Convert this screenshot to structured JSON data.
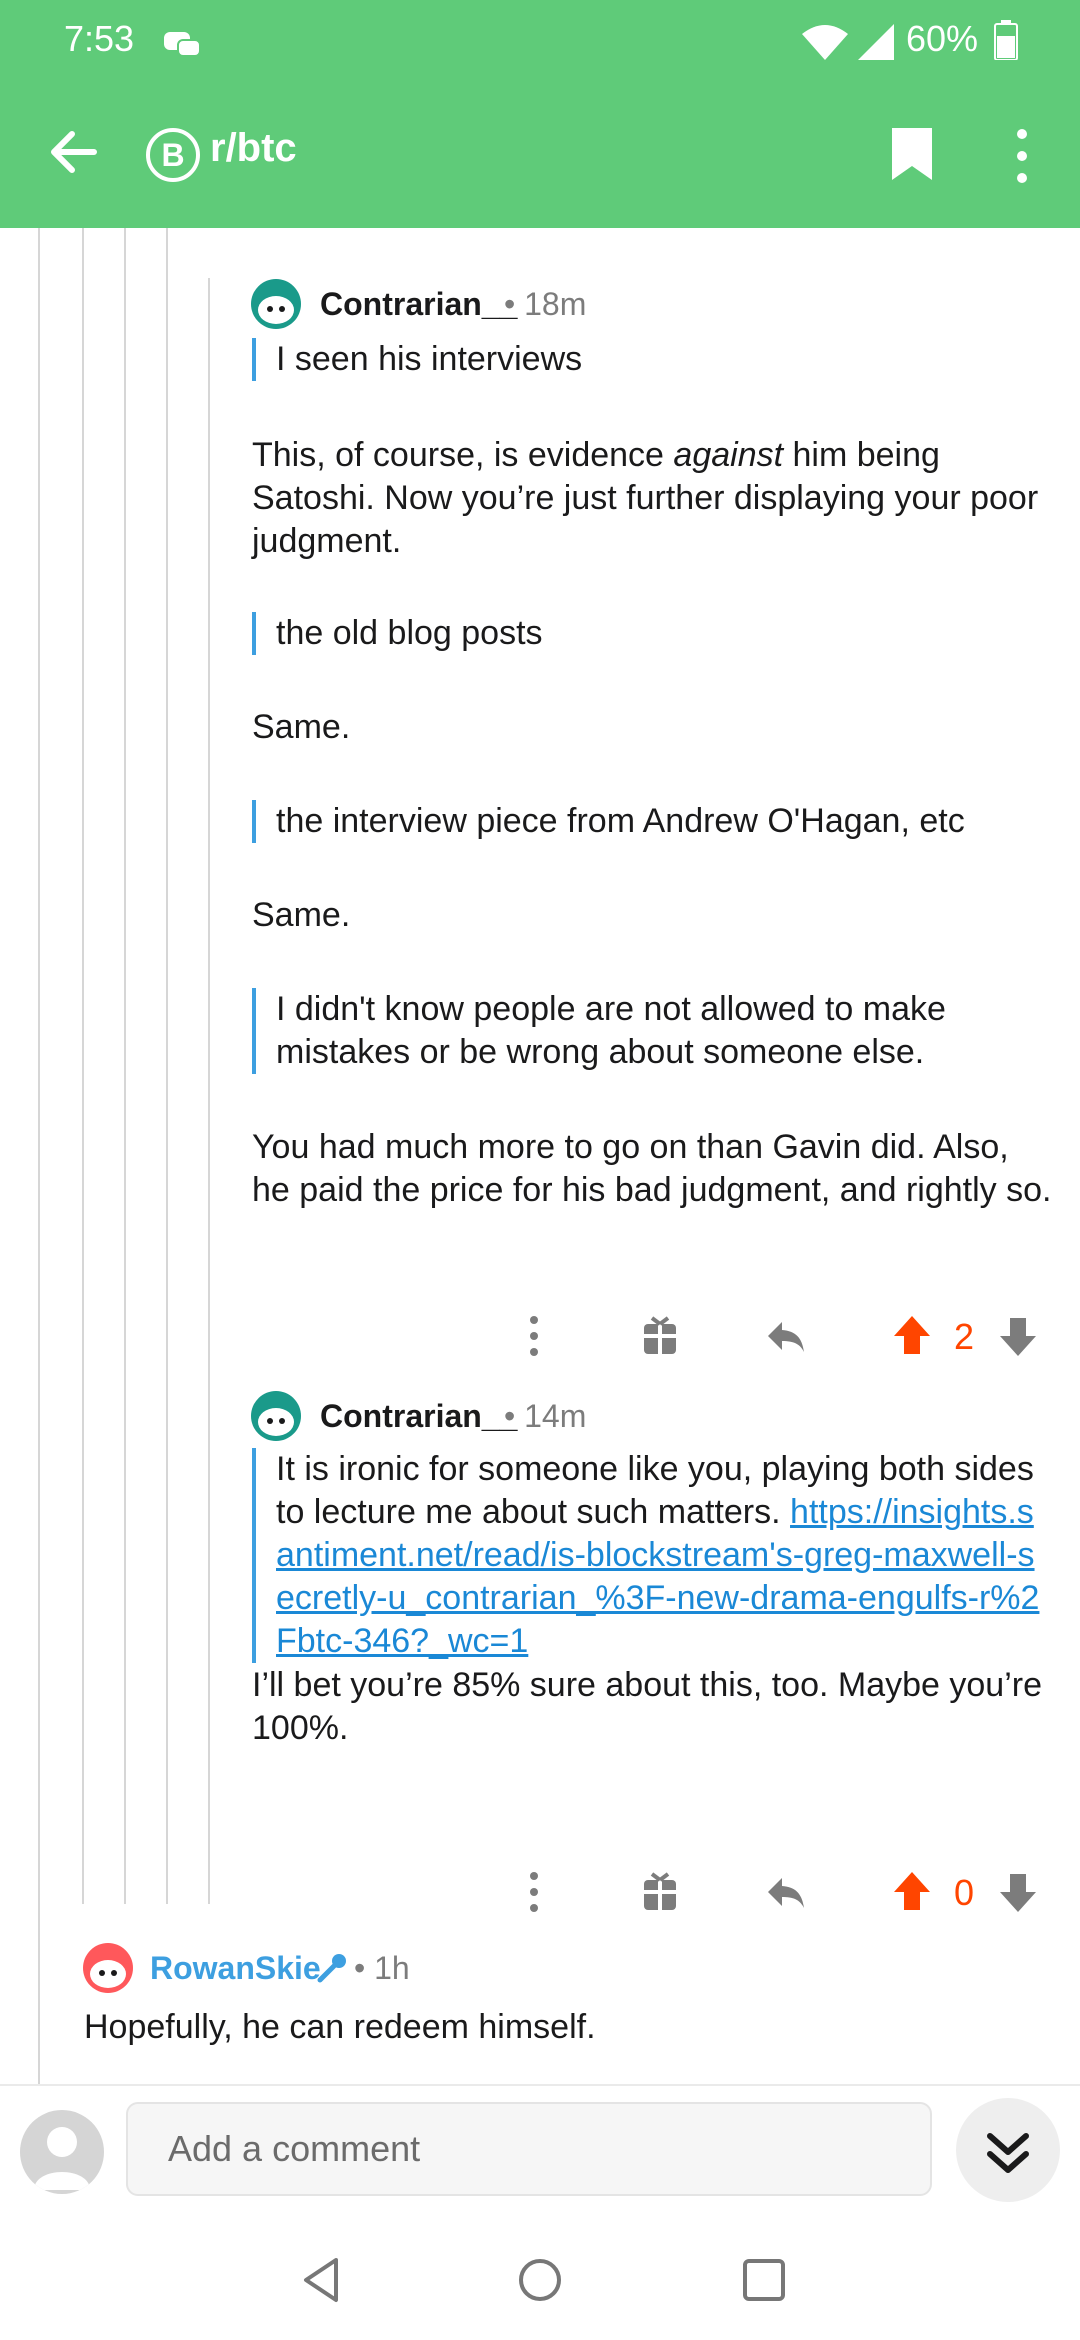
{
  "status_bar": {
    "time": "7:53",
    "battery": "60%"
  },
  "header": {
    "subreddit": "r/btc",
    "subreddit_icon_glyph": "B"
  },
  "comments": [
    {
      "author": "Contrarian__",
      "time": "• 18m",
      "quote1": "I seen his interviews",
      "p1_before": "This, of course, is evidence ",
      "p1_em": "against",
      "p1_after": " him being Satoshi. Now you’re just further displaying your poor judgment.",
      "quote2": "the old blog posts",
      "p2": "Same.",
      "quote3": "the interview piece from Andrew O'Hagan, etc",
      "p3": "Same.",
      "quote4": "I didn't know people are not allowed to make mistakes or be wrong about someone else.",
      "p4": "You had much more to go on than Gavin did. Also, he paid the price for his bad judgment, and rightly so.",
      "score": "2"
    },
    {
      "author": "Contrarian__",
      "time": "• 14m",
      "quote_text": "It is ironic for someone like you, playing both sides to lecture me about such matters. ",
      "quote_link": "https://insights.santiment.net/read/is-blockstream's-greg-maxwell-secretly-u_contrarian_%3F-new-drama-engulfs-r%2Fbtc-346?_wc=1",
      "p1": "I’ll bet you’re 85% sure about this, too. Maybe you’re 100%.",
      "score": "0"
    },
    {
      "author": "RowanSkie",
      "time": "• 1h",
      "body": "Hopefully, he can redeem himself."
    }
  ],
  "composer": {
    "placeholder": "Add a comment"
  },
  "colors": {
    "app_bar": "#5fcb79",
    "quote_bar": "#3d9fe0",
    "link": "#1a88d6",
    "upvote": "#ff4500",
    "author_blue": "#3d9fe0"
  }
}
